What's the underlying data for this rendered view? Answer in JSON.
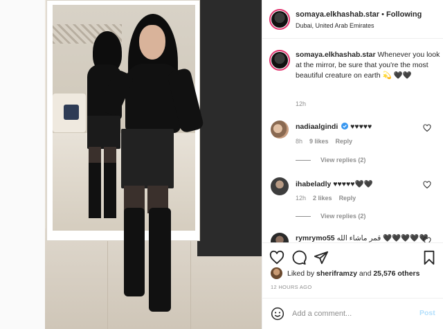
{
  "header": {
    "username": "somaya.elkhashab.star",
    "separator": " • ",
    "follow_label": "Following",
    "location": "Dubai, United Arab Emirates"
  },
  "caption": {
    "username": "somaya.elkhashab.star",
    "text": " Whenever you look at the mirror, be sure that you're the most beautiful creature on earth 💫 🖤🖤",
    "time": "12h"
  },
  "comments": [
    {
      "username": "nadiaalgindi",
      "text": " ♥♥♥♥♥",
      "time": "8h",
      "likes": "9 likes",
      "reply": "Reply",
      "view_replies": "View replies (2)"
    },
    {
      "username": "ihabeladly",
      "text": " ♥♥♥♥♥🖤🖤",
      "time": "12h",
      "likes": "2 likes",
      "reply": "Reply",
      "view_replies": "View replies (2)"
    },
    {
      "username": "rymrymo55",
      "text": " قمر ماشاء الله 🖤🖤🖤🖤🖤"
    }
  ],
  "likes": {
    "prefix": "Liked by ",
    "user": "sheriframzy",
    "middle": " and ",
    "count": "25,576 others"
  },
  "timestamp": "12 HOURS AGO",
  "add_comment": {
    "placeholder": "Add a comment...",
    "post_label": "Post"
  },
  "icons": {
    "like": "heart-icon",
    "comment": "comment-icon",
    "share": "share-icon",
    "save": "bookmark-icon",
    "emoji": "emoji-icon"
  },
  "colors": {
    "verified": "#3897f0",
    "post_disabled": "#b2dffc",
    "story_ring": "#e1306c"
  }
}
